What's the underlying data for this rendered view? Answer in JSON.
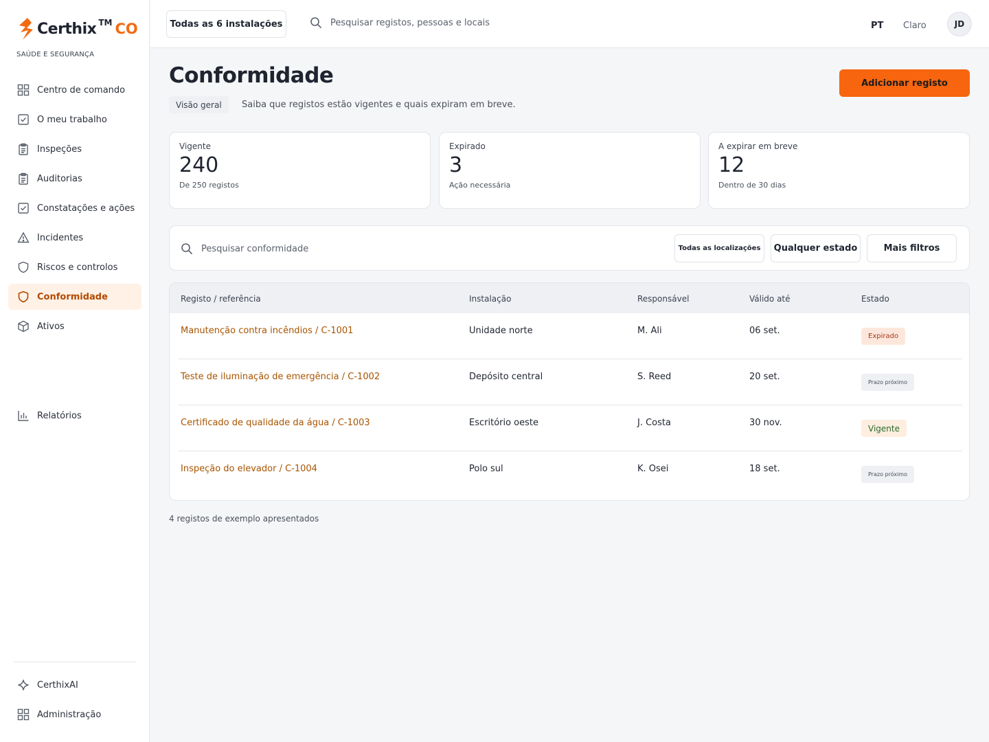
{
  "brand": {
    "name": "Certhix",
    "tm": "TM",
    "suffix": "CO",
    "tagline": "SAÚDE E SEGURANÇA",
    "accent": "#f26b12"
  },
  "sidebar": {
    "items": [
      {
        "label": "Centro de comando",
        "icon": "grid-icon"
      },
      {
        "label": "O meu trabalho",
        "icon": "checkbox-icon"
      },
      {
        "label": "Inspeções",
        "icon": "clipboard-icon"
      },
      {
        "label": "Auditorias",
        "icon": "clipboard-icon"
      },
      {
        "label": "Constatações e ações",
        "icon": "checkbox-icon"
      },
      {
        "label": "Incidentes",
        "icon": "warning-icon"
      },
      {
        "label": "Riscos e controlos",
        "icon": "shield-icon"
      },
      {
        "label": "Conformidade",
        "icon": "shield-icon",
        "active": true
      },
      {
        "label": "Ativos",
        "icon": "box-icon"
      }
    ],
    "reports": {
      "label": "Relatórios",
      "icon": "bar-chart-icon"
    },
    "bottom": [
      {
        "label": "CerthixAI",
        "icon": "sparkle-icon"
      },
      {
        "label": "Administração",
        "icon": "grid-icon"
      }
    ]
  },
  "topbar": {
    "site_selector": "Todas as 6 instalações",
    "search_placeholder": "Pesquisar registos, pessoas e locais",
    "language": "PT",
    "theme": "Claro",
    "avatar_initials": "JD"
  },
  "page": {
    "title": "Conformidade",
    "breadcrumb": "Visão geral",
    "subtitle": "Saiba que registos estão vigentes e quais expiram em breve.",
    "add_button": "Adicionar registo"
  },
  "stats": [
    {
      "label": "Vigente",
      "value": "240",
      "note": "De 250 registos"
    },
    {
      "label": "Expirado",
      "value": "3",
      "note": "Ação necessária"
    },
    {
      "label": "A expirar em breve",
      "value": "12",
      "note": "Dentro de 30 dias"
    }
  ],
  "filters": {
    "search_placeholder": "Pesquisar conformidade",
    "locations": "Todas as localizações",
    "status": "Qualquer estado",
    "more": "Mais filtros"
  },
  "table": {
    "headers": [
      "Registo / referência",
      "Instalação",
      "Responsável",
      "Válido até",
      "Estado"
    ],
    "rows": [
      {
        "record": "Manutenção contra incêndios / C-1001",
        "site": "Unidade norte",
        "owner": "M. Ali",
        "valid_until": "06 set.",
        "status": "Expirado",
        "status_kind": "expired"
      },
      {
        "record": "Teste de iluminação de emergência / C-1002",
        "site": "Depósito central",
        "owner": "S. Reed",
        "valid_until": "20 set.",
        "status": "Prazo próximo",
        "status_kind": "soon"
      },
      {
        "record": "Certificado de qualidade da água / C-1003",
        "site": "Escritório oeste",
        "owner": "J. Costa",
        "valid_until": "30 nov.",
        "status": "Vigente",
        "status_kind": "valid"
      },
      {
        "record": "Inspeção do elevador / C-1004",
        "site": "Polo sul",
        "owner": "K. Osei",
        "valid_until": "18 set.",
        "status": "Prazo próximo",
        "status_kind": "soon"
      }
    ]
  },
  "footnote": "4 registos de exemplo apresentados"
}
